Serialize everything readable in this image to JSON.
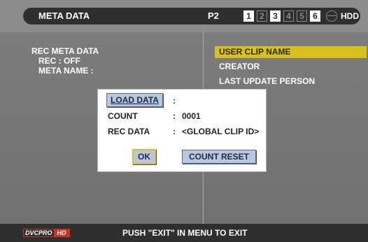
{
  "header": {
    "title": "META DATA",
    "p2_label": "P2",
    "slots": [
      {
        "label": "1",
        "active": true
      },
      {
        "label": "2",
        "active": false
      },
      {
        "label": "3",
        "active": true
      },
      {
        "label": "4",
        "active": false
      },
      {
        "label": "5",
        "active": false
      },
      {
        "label": "6",
        "active": true
      }
    ],
    "hdd_label": "HDD"
  },
  "left_panel": {
    "heading": "REC META DATA",
    "rec": "REC : OFF",
    "meta_name": "META NAME :"
  },
  "menu": {
    "items": [
      "USER CLIP NAME",
      "CREATOR",
      "LAST UPDATE PERSON"
    ],
    "selected_index": 0
  },
  "dialog": {
    "load_data_button": "LOAD DATA",
    "load_data_sep": ":",
    "count_label": "COUNT",
    "count_sep": ":",
    "count_value": "0001",
    "rec_data_label": "REC DATA",
    "rec_data_sep": ":",
    "rec_data_value": "<GLOBAL CLIP ID>",
    "ok_button": "OK",
    "count_reset_button": "COUNT RESET"
  },
  "footer": {
    "logo_dvcpro": "DVCPRO",
    "logo_hd": "HD",
    "instruction": "PUSH \"EXIT\" IN MENU TO EXIT"
  },
  "colors": {
    "highlight": "#d8c21a",
    "bar": "#2f2f2f",
    "button": "#b8c6df"
  }
}
